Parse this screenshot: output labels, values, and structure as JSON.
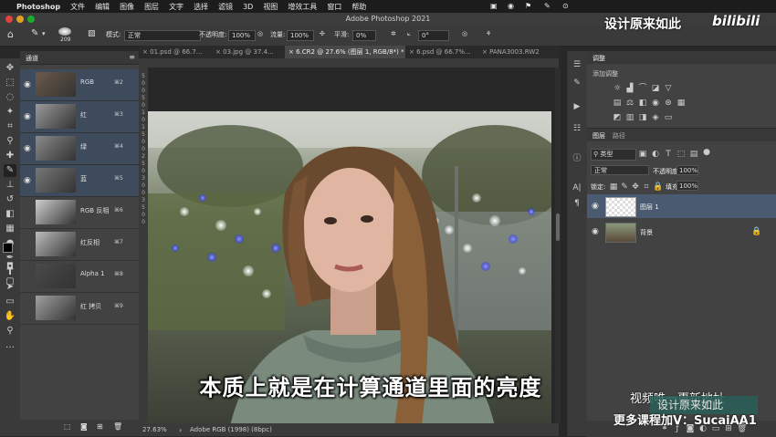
{
  "menubar": {
    "app_name": "Photoshop",
    "items": [
      "文件",
      "编辑",
      "图像",
      "图层",
      "文字",
      "选择",
      "滤镜",
      "3D",
      "视图",
      "增效工具",
      "窗口",
      "帮助"
    ]
  },
  "window": {
    "title": "Adobe Photoshop 2021"
  },
  "options": {
    "brush_size": "209",
    "mode_label": "模式:",
    "mode_value": "正常",
    "opacity_label": "不透明度:",
    "opacity_value": "100%",
    "flow_label": "流量:",
    "flow_value": "100%",
    "smooth_label": "平滑:",
    "smooth_value": "0%",
    "angle_value": "0°"
  },
  "doc_tabs": [
    {
      "label": "01.psd @ 66.7...",
      "active": false
    },
    {
      "label": "03.jpg @ 37.4...",
      "active": false
    },
    {
      "label": "6.CR2 @ 27.6% (图层 1, RGB/8*) *",
      "active": true
    },
    {
      "label": "6.psd @ 66.7%...",
      "active": false
    },
    {
      "label": "PANA3003.RW2",
      "active": false
    }
  ],
  "channels": {
    "tab": "通道",
    "rows": [
      {
        "name": "RGB",
        "shortcut": "⌘2",
        "selected": true
      },
      {
        "name": "红",
        "shortcut": "⌘3",
        "selected": true
      },
      {
        "name": "绿",
        "shortcut": "⌘4",
        "selected": true
      },
      {
        "name": "蓝",
        "shortcut": "⌘5",
        "selected": true
      },
      {
        "name": "RGB 反相",
        "shortcut": "⌘6",
        "selected": false
      },
      {
        "name": "红反相",
        "shortcut": "⌘7",
        "selected": false
      },
      {
        "name": "Alpha 1",
        "shortcut": "⌘8",
        "selected": false
      },
      {
        "name": "红 拷贝",
        "shortcut": "⌘9",
        "selected": false
      }
    ]
  },
  "rulers": {
    "left_ticks": [
      "5",
      "0",
      "0",
      "5",
      "0",
      "1",
      "0",
      "1",
      "5",
      "0",
      "0",
      "2",
      "5",
      "0",
      "3",
      "0",
      "0",
      "3",
      "5",
      "0",
      "0"
    ]
  },
  "status": {
    "zoom": "27.63%",
    "profile": "Adobe RGB (1998) (8bpc)"
  },
  "adjustments": {
    "tab": "调整",
    "add_label": "添加调整"
  },
  "layers": {
    "tabs": [
      "图层",
      "路径"
    ],
    "filter_kind": "类型",
    "blend_mode": "正常",
    "opacity_label": "不透明度:",
    "opacity_value": "100%",
    "lock_label": "锁定:",
    "fill_label": "填充:",
    "fill_value": "100%",
    "items": [
      {
        "name": "图层 1",
        "selected": true
      },
      {
        "name": "背景",
        "selected": false
      }
    ]
  },
  "subtitle": "本质上就是在计算通道里面的亮度",
  "watermarks": {
    "top_cn": "设计原来如此",
    "top_logo": "bilibili",
    "bottom_a": "视频唯一更新地址",
    "bottom_b": "更多课程加V：SucaiAA1",
    "bottom_badge": "设计原来如此"
  },
  "colors": {
    "selection": "#3e4b5c",
    "layer_sel": "#4a5a70",
    "panel": "#424242"
  }
}
